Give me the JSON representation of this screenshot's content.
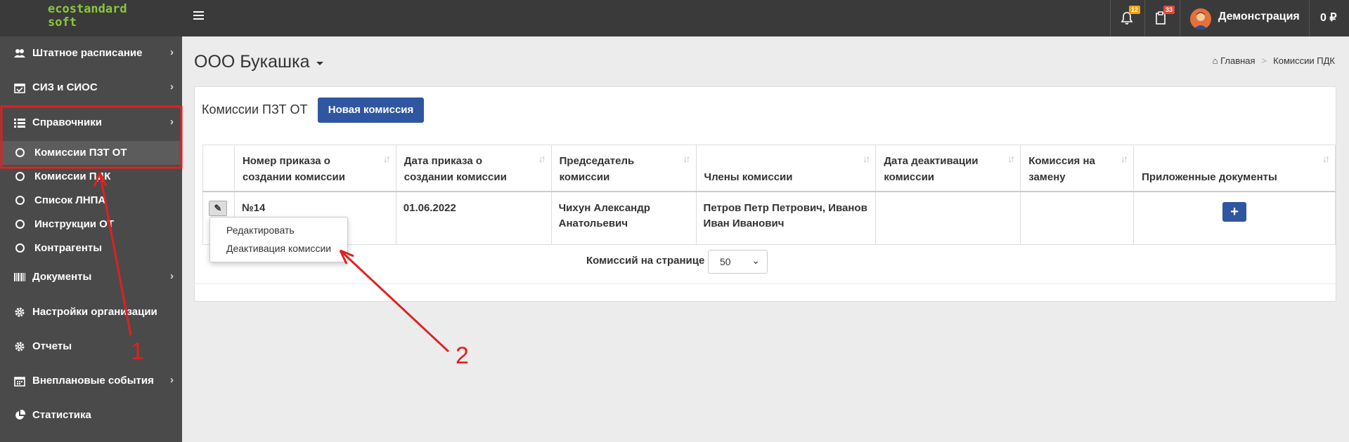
{
  "brand": {
    "line1": "ecostandard",
    "line2": "soft"
  },
  "topbar": {
    "notifications_count": "12",
    "tasks_count": "33",
    "user_name": "Демонстрация",
    "balance": "0 ₽",
    "colors": {
      "bar": "#3a3a3a",
      "badge_orange": "#f0a30a",
      "badge_red": "#e04a3a"
    }
  },
  "sidebar": {
    "items": [
      {
        "label": "Штатное расписание",
        "icon": "users-icon"
      },
      {
        "label": "СИЗ и СИОС",
        "icon": "calendar-check-icon"
      },
      {
        "label": "Справочники",
        "icon": "list-icon"
      },
      {
        "label": "Документы",
        "icon": "barcode-icon"
      },
      {
        "label": "Настройки организации",
        "icon": "gear-icon"
      },
      {
        "label": "Отчеты",
        "icon": "gear-icon"
      },
      {
        "label": "Внеплановые события",
        "icon": "calendar-icon"
      },
      {
        "label": "Статистика",
        "icon": "pie-chart-icon"
      }
    ],
    "subitems": [
      {
        "label": "Комиссии ПЗТ ОТ"
      },
      {
        "label": "Комиссии ПДК"
      },
      {
        "label": "Список ЛНПА"
      },
      {
        "label": "Инструкции ОТ"
      },
      {
        "label": "Контрагенты"
      }
    ]
  },
  "page": {
    "title": "ООО Букашка",
    "breadcrumb": {
      "home": "Главная",
      "current": "Комиссии ПДК"
    }
  },
  "panel": {
    "title": "Комиссии ПЗТ ОТ",
    "new_button": "Новая комиссия",
    "table": {
      "headers": [
        "Номер приказа о создании комиссии",
        "Дата приказа о создании комиссии",
        "Председатель комиссии",
        "Члены комиссии",
        "Дата деактивации комиссии",
        "Комиссия на замену",
        "Приложенные документы"
      ],
      "rows": [
        {
          "order_no": "№14",
          "order_date": "01.06.2022",
          "chairman": "Чихун Александр Анатольевич",
          "members": "Петров Петр Петрович, Иванов Иван Иванович",
          "deactivation_date": "",
          "replacement": ""
        }
      ]
    },
    "pager": {
      "label": "Комиссий на странице",
      "value": "50"
    }
  },
  "row_menu": {
    "edit": "Редактировать",
    "deactivate": "Деактивация комиссии"
  },
  "annotations": {
    "one": "1",
    "two": "2",
    "color": "#e02020"
  }
}
